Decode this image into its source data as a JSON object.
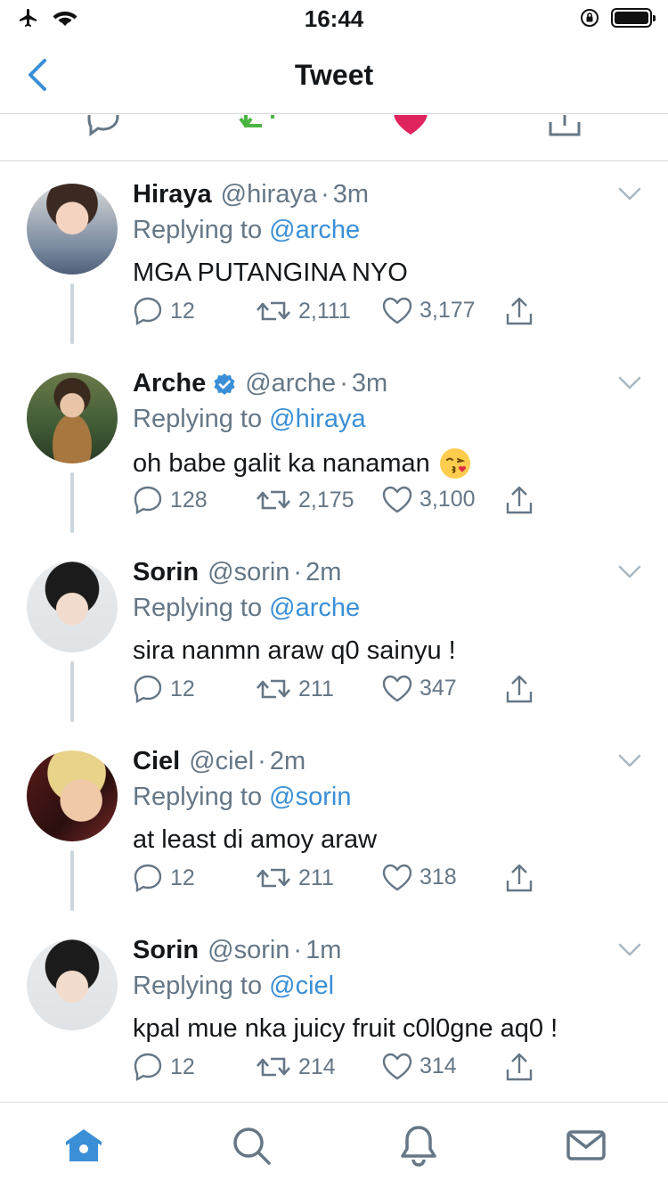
{
  "status": {
    "time": "16:44",
    "icons": [
      "airplane-icon",
      "wifi-icon",
      "orientation-lock-icon",
      "battery-icon"
    ]
  },
  "nav": {
    "title": "Tweet",
    "back_icon": "chevron-left-icon"
  },
  "colors": {
    "accent": "#3a8fd6",
    "secondary_text": "#657786",
    "retweet_green": "#4bb543",
    "like_red": "#e0245e",
    "divider": "#d6d9dc"
  },
  "labels": {
    "replying_to": "Replying to"
  },
  "replies": [
    {
      "name": "Hiraya",
      "handle": "@hiraya",
      "time": "3m",
      "verified": false,
      "reply_to": "@arche",
      "text": "MGA PUTANGINA NYO",
      "emoji": "",
      "replies": "12",
      "retweets": "2,111",
      "likes": "3,177"
    },
    {
      "name": "Arche",
      "handle": "@arche",
      "time": "3m",
      "verified": true,
      "reply_to": "@hiraya",
      "text": "oh babe galit ka nanaman",
      "emoji": "kissing-face-emoji",
      "replies": "128",
      "retweets": "2,175",
      "likes": "3,100"
    },
    {
      "name": "Sorin",
      "handle": "@sorin",
      "time": "2m",
      "verified": false,
      "reply_to": "@arche",
      "text": "sira nanmn araw q0 sainyu !",
      "emoji": "",
      "replies": "12",
      "retweets": "211",
      "likes": "347"
    },
    {
      "name": "Ciel",
      "handle": "@ciel",
      "time": "2m",
      "verified": false,
      "reply_to": "@sorin",
      "text": "at least di amoy araw",
      "emoji": "",
      "replies": "12",
      "retweets": "211",
      "likes": "318"
    },
    {
      "name": "Sorin",
      "handle": "@sorin",
      "time": "1m",
      "verified": false,
      "reply_to": "@ciel",
      "text": "kpal mue nka juicy fruit c0l0gne aq0 !",
      "emoji": "",
      "replies": "12",
      "retweets": "214",
      "likes": "314"
    }
  ],
  "tabs": [
    "home-icon",
    "search-icon",
    "notifications-icon",
    "messages-icon"
  ]
}
